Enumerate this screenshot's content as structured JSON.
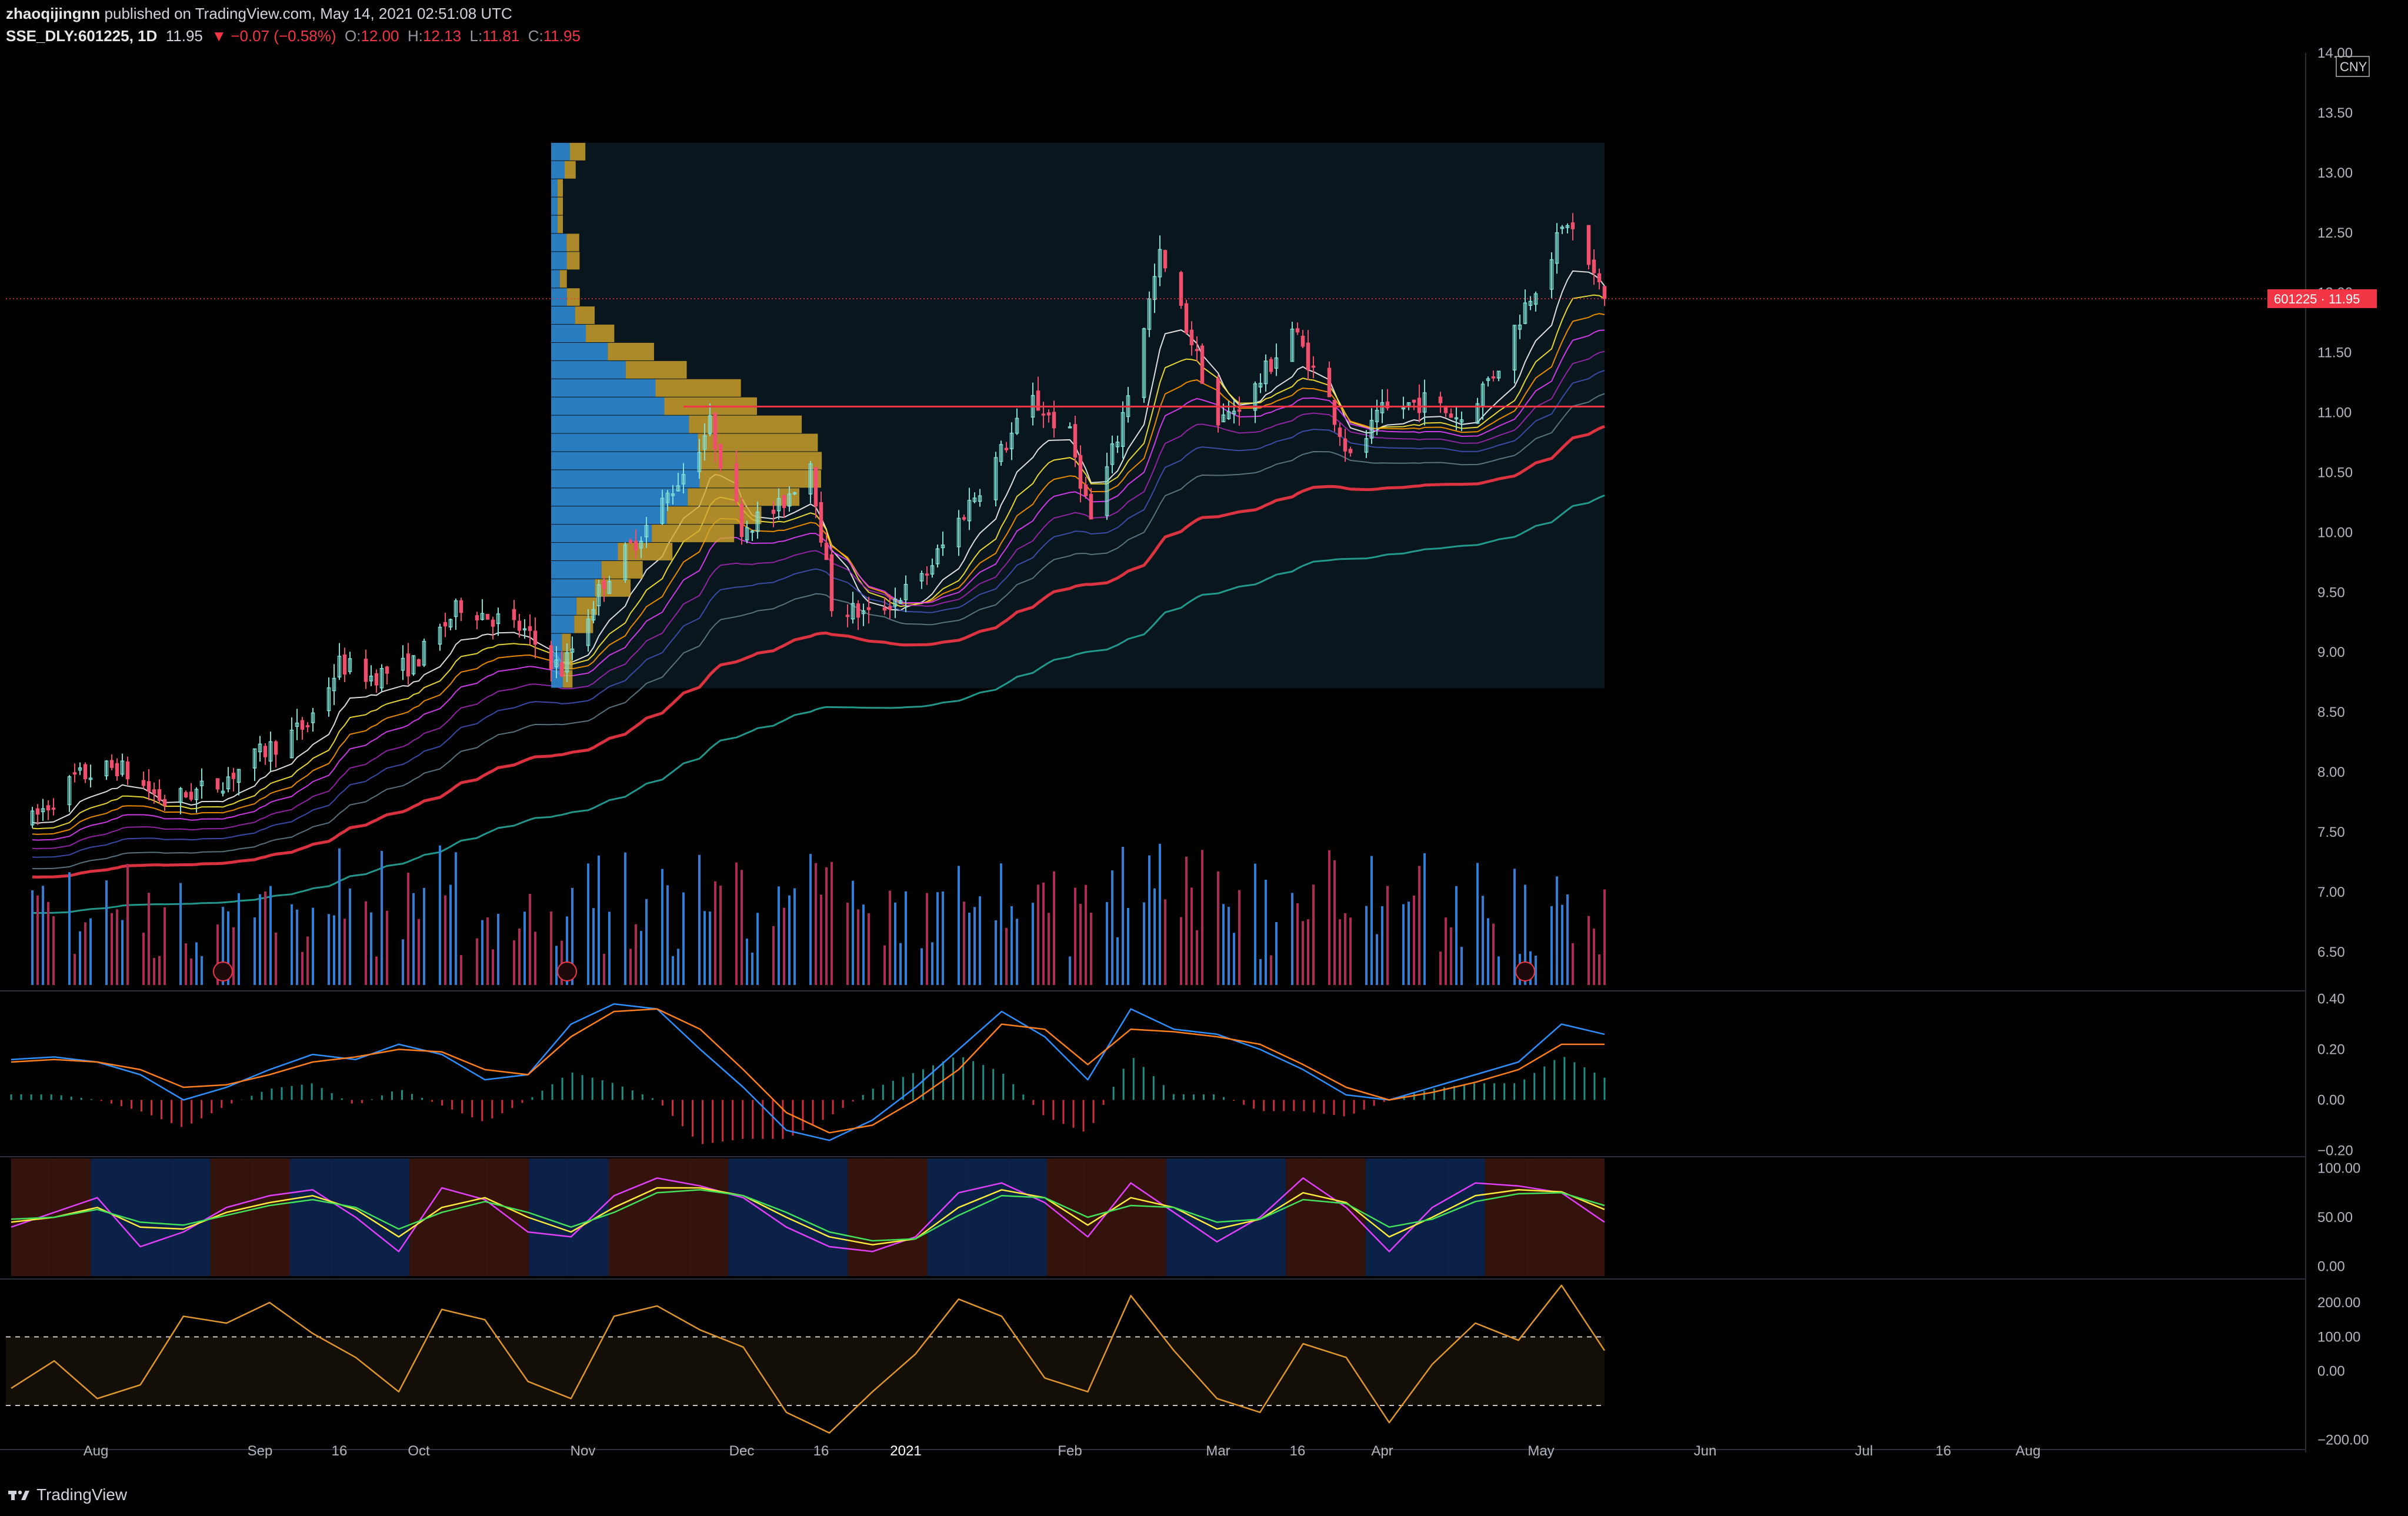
{
  "header": {
    "author": "zhaoqijingnn",
    "published_text": "published on TradingView.com, May 14, 2021 02:51:08 UTC",
    "symbol": "SSE_DLY:601225, 1D",
    "last": "11.95",
    "change": "▼ −0.07 (−0.58%)",
    "o_label": "O:",
    "o_value": "12.00",
    "h_label": "H:",
    "h_value": "12.13",
    "l_label": "L:",
    "l_value": "11.81",
    "c_label": "C:",
    "c_value": "11.95"
  },
  "footer": {
    "brand": "TradingView"
  },
  "colors": {
    "up": "#26a69a",
    "up_candle": "#7fded3",
    "down": "#f23645",
    "down_candle": "#ef4f6c",
    "vol_up": "#2f7fd6",
    "vol_down": "#b02a58",
    "accent": "#f23645"
  },
  "chart_data": [
    {
      "type": "candlestick",
      "title": "SSE_DLY:601225, 1D",
      "currency": "CNY",
      "price_tag": "601225 · 11.95",
      "last_price": 11.95,
      "y_ticks": [
        "14.00",
        "13.50",
        "13.00",
        "12.50",
        "12.00",
        "11.50",
        "11.00",
        "10.50",
        "10.00",
        "9.50",
        "9.00",
        "8.50",
        "8.00",
        "7.50",
        "7.00",
        "6.50"
      ],
      "ylim": [
        6.2,
        14.0
      ],
      "x_ticks": [
        "Aug",
        "Sep",
        "16",
        "Oct",
        "Nov",
        "Dec",
        "16",
        "2021",
        "Feb",
        "Mar",
        "16",
        "Apr",
        "May",
        "Jun",
        "Jul",
        "16",
        "Aug"
      ],
      "close_path": [
        {
          "date": "2020-07-20",
          "close": 7.6
        },
        {
          "date": "2020-07-28",
          "close": 7.95
        },
        {
          "date": "2020-08-05",
          "close": 8.05
        },
        {
          "date": "2020-08-14",
          "close": 7.75
        },
        {
          "date": "2020-08-24",
          "close": 7.9
        },
        {
          "date": "2020-09-01",
          "close": 8.15
        },
        {
          "date": "2020-09-10",
          "close": 8.4
        },
        {
          "date": "2020-09-16",
          "close": 8.9
        },
        {
          "date": "2020-09-22",
          "close": 8.8
        },
        {
          "date": "2020-09-30",
          "close": 8.9
        },
        {
          "date": "2020-10-09",
          "close": 9.4
        },
        {
          "date": "2020-10-20",
          "close": 9.2
        },
        {
          "date": "2020-10-28",
          "close": 8.85
        },
        {
          "date": "2020-11-05",
          "close": 9.6
        },
        {
          "date": "2020-11-13",
          "close": 10.05
        },
        {
          "date": "2020-11-20",
          "close": 10.5
        },
        {
          "date": "2020-11-25",
          "close": 10.9
        },
        {
          "date": "2020-12-01",
          "close": 10.05
        },
        {
          "date": "2020-12-08",
          "close": 10.2
        },
        {
          "date": "2020-12-14",
          "close": 10.6
        },
        {
          "date": "2020-12-18",
          "close": 9.4
        },
        {
          "date": "2020-12-25",
          "close": 9.3
        },
        {
          "date": "2021-01-04",
          "close": 9.6
        },
        {
          "date": "2021-01-11",
          "close": 10.1
        },
        {
          "date": "2021-01-18",
          "close": 10.6
        },
        {
          "date": "2021-01-25",
          "close": 11.1
        },
        {
          "date": "2021-02-01",
          "close": 10.8
        },
        {
          "date": "2021-02-05",
          "close": 10.1
        },
        {
          "date": "2021-02-10",
          "close": 10.8
        },
        {
          "date": "2021-02-18",
          "close": 12.3
        },
        {
          "date": "2021-02-24",
          "close": 11.6
        },
        {
          "date": "2021-03-01",
          "close": 10.9
        },
        {
          "date": "2021-03-08",
          "close": 11.2
        },
        {
          "date": "2021-03-15",
          "close": 11.7
        },
        {
          "date": "2021-03-22",
          "close": 11.1
        },
        {
          "date": "2021-03-26",
          "close": 10.6
        },
        {
          "date": "2021-04-01",
          "close": 11.0
        },
        {
          "date": "2021-04-09",
          "close": 11.1
        },
        {
          "date": "2021-04-16",
          "close": 10.95
        },
        {
          "date": "2021-04-23",
          "close": 11.4
        },
        {
          "date": "2021-04-28",
          "close": 11.9
        },
        {
          "date": "2021-05-06",
          "close": 12.6
        },
        {
          "date": "2021-05-13",
          "close": 11.95
        }
      ],
      "horizontal_line": 11.05,
      "volume_profile_range": {
        "from": "2020-10-26",
        "to": "2021-05-13",
        "price_low": 8.7,
        "price_high": 13.25
      }
    },
    {
      "type": "line",
      "title": "MACD",
      "y_ticks": [
        "0.40",
        "0.20",
        "0.00",
        "−0.20"
      ],
      "ylim": [
        -0.22,
        0.42
      ],
      "series": [
        {
          "color": "#2f8fff",
          "values": [
            0.16,
            0.17,
            0.15,
            0.1,
            0.0,
            0.05,
            0.12,
            0.18,
            0.16,
            0.22,
            0.18,
            0.08,
            0.1,
            0.3,
            0.38,
            0.36,
            0.2,
            0.05,
            -0.12,
            -0.16,
            -0.08,
            0.05,
            0.2,
            0.35,
            0.25,
            0.08,
            0.36,
            0.28,
            0.26,
            0.2,
            0.12,
            0.02,
            0.0,
            0.05,
            0.1,
            0.15,
            0.3,
            0.26
          ]
        },
        {
          "color": "#ff7f1e",
          "values": [
            0.15,
            0.16,
            0.15,
            0.12,
            0.05,
            0.06,
            0.1,
            0.15,
            0.17,
            0.2,
            0.19,
            0.12,
            0.1,
            0.25,
            0.35,
            0.36,
            0.28,
            0.12,
            -0.05,
            -0.13,
            -0.1,
            0.0,
            0.12,
            0.3,
            0.28,
            0.14,
            0.28,
            0.27,
            0.25,
            0.22,
            0.14,
            0.05,
            0.0,
            0.03,
            0.07,
            0.12,
            0.22,
            0.22
          ]
        }
      ]
    },
    {
      "type": "line",
      "title": "Stochastic RSI",
      "y_ticks": [
        "100.00",
        "50.00",
        "0.00"
      ],
      "ylim": [
        -10,
        110
      ],
      "series": [
        {
          "color": "#e040fb",
          "values": [
            40,
            55,
            70,
            20,
            35,
            60,
            72,
            78,
            50,
            15,
            80,
            68,
            35,
            30,
            72,
            90,
            82,
            70,
            40,
            20,
            15,
            30,
            75,
            85,
            65,
            30,
            85,
            55,
            25,
            50,
            90,
            60,
            15,
            60,
            85,
            82,
            75,
            45
          ]
        },
        {
          "color": "#ffeb3b",
          "values": [
            45,
            50,
            60,
            40,
            38,
            55,
            65,
            72,
            58,
            30,
            60,
            70,
            50,
            35,
            60,
            80,
            80,
            72,
            50,
            30,
            22,
            28,
            60,
            78,
            70,
            42,
            70,
            60,
            38,
            48,
            75,
            65,
            30,
            50,
            72,
            78,
            76,
            58
          ]
        },
        {
          "color": "#43e05a",
          "values": [
            48,
            50,
            58,
            45,
            42,
            52,
            62,
            68,
            60,
            38,
            55,
            66,
            55,
            40,
            55,
            75,
            78,
            72,
            55,
            35,
            26,
            28,
            52,
            72,
            70,
            50,
            62,
            60,
            45,
            48,
            68,
            64,
            40,
            48,
            66,
            74,
            75,
            62
          ]
        }
      ]
    },
    {
      "type": "line",
      "title": "CCI",
      "y_ticks": [
        "200.00",
        "100.00",
        "0.00",
        "−200.00"
      ],
      "ylim": [
        -220,
        260
      ],
      "bands": [
        100,
        -100
      ],
      "series": [
        {
          "color": "#e0962e",
          "values": [
            -50,
            30,
            -80,
            -40,
            160,
            140,
            200,
            110,
            40,
            -60,
            180,
            150,
            -30,
            -80,
            160,
            190,
            120,
            70,
            -120,
            -180,
            -60,
            50,
            210,
            160,
            -20,
            -60,
            220,
            60,
            -80,
            -120,
            80,
            40,
            -150,
            20,
            140,
            90,
            250,
            60
          ]
        }
      ]
    }
  ]
}
